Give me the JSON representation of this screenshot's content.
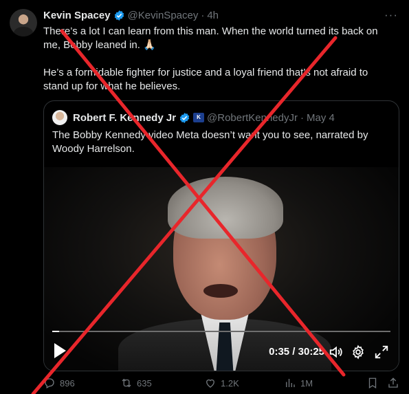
{
  "tweet": {
    "author_name": "Kevin Spacey",
    "handle": "@KevinSpacey",
    "separator": "·",
    "time": "4h",
    "more": "···",
    "text_line1": "There’s a lot I can learn from this man. When the world turned its back on me, Bobby leaned in. 🙏🏻",
    "text_line2": "He’s a formidable fighter for justice and a loyal friend that’s not afraid to stand up for what he believes."
  },
  "quote": {
    "author_name": "Robert F. Kennedy Jr",
    "badge_text": "K",
    "handle": "@RobertKennedyJr",
    "separator": "·",
    "date": "May 4",
    "text": "The Bobby Kennedy video Meta doesn’t want you to see, narrated by Woody Harrelson."
  },
  "video": {
    "time_display": "0:35 / 30:25",
    "progress": 0.02
  },
  "actions": {
    "replies": "896",
    "reposts": "635",
    "likes": "1.2K",
    "views": "1M"
  },
  "colors": {
    "verified": "#1d9bf0",
    "overlay_x": "#e8262b",
    "muted": "#71767b"
  },
  "icons": [
    "verified-icon",
    "more-icon",
    "play-icon",
    "volume-icon",
    "settings-icon",
    "fullscreen-icon",
    "reply-icon",
    "repost-icon",
    "like-icon",
    "views-icon",
    "bookmark-icon",
    "share-icon"
  ]
}
